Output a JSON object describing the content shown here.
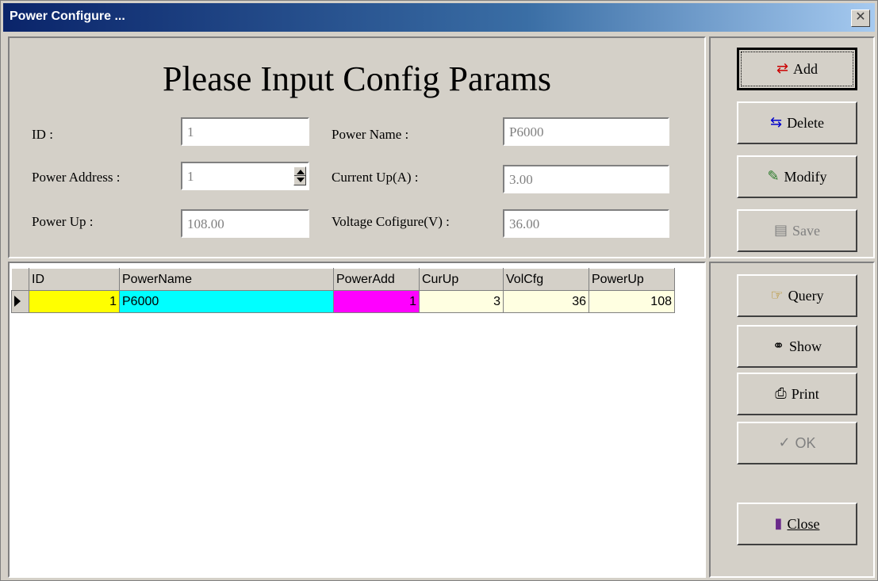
{
  "window": {
    "title": "Power Configure ..."
  },
  "form": {
    "heading": "Please Input Config Params",
    "id_label": "ID :",
    "id_value": "1",
    "power_name_label": "Power Name :",
    "power_name_value": "P6000",
    "power_address_label": "Power Address :",
    "power_address_value": "1",
    "current_up_label": "Current Up(A) :",
    "current_up_value": "3.00",
    "power_up_label": "Power Up :",
    "power_up_value": "108.00",
    "voltage_label": "Voltage Cofigure(V) :",
    "voltage_value": "36.00"
  },
  "buttons": {
    "add": "Add",
    "delete": "Delete",
    "modify": "Modify",
    "save": "Save",
    "query": "Query",
    "show": "Show",
    "print": "Print",
    "ok": "OK",
    "close": "Close"
  },
  "grid": {
    "columns": [
      "ID",
      "PowerName",
      "PowerAdd",
      "CurUp",
      "VolCfg",
      "PowerUp"
    ],
    "rows": [
      {
        "id": "1",
        "name": "P6000",
        "addr": "1",
        "cur": "3",
        "vol": "36",
        "pwr": "108"
      }
    ]
  },
  "colors": {
    "id_cell": "#ffff00",
    "name_cell": "#00ffff",
    "addr_cell": "#ff00ff",
    "num_cell": "#ffffe1"
  }
}
